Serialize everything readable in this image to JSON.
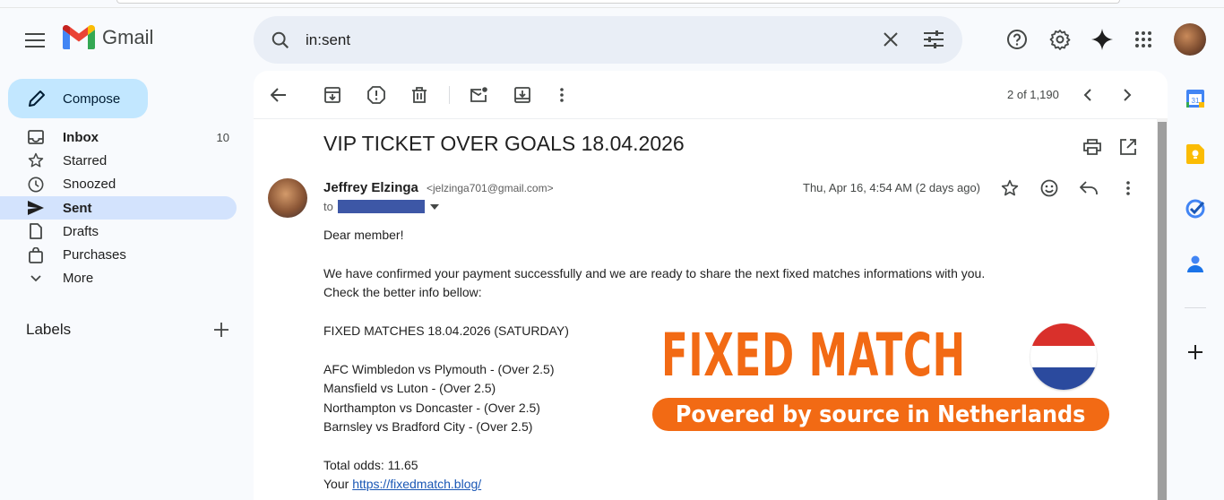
{
  "app": {
    "name": "Gmail",
    "brand_colors": {
      "red": "#ea4335",
      "blue": "#4285f4",
      "green": "#34a853",
      "yellow": "#fbbc04"
    }
  },
  "search": {
    "value": "in:sent",
    "icons": [
      "search-icon",
      "clear-icon",
      "tune-icon"
    ]
  },
  "header_icons": [
    "help-icon",
    "settings-icon",
    "gemini-icon",
    "apps-icon"
  ],
  "compose": {
    "label": "Compose"
  },
  "sidebar": {
    "items": [
      {
        "label": "Inbox",
        "count": "10",
        "icon": "inbox-icon"
      },
      {
        "label": "Starred",
        "icon": "star-icon"
      },
      {
        "label": "Snoozed",
        "icon": "clock-icon"
      },
      {
        "label": "Sent",
        "icon": "send-icon",
        "active": true
      },
      {
        "label": "Drafts",
        "icon": "draft-icon"
      },
      {
        "label": "Purchases",
        "icon": "bag-icon"
      },
      {
        "label": "More",
        "icon": "chevron-down-icon"
      }
    ],
    "labels_title": "Labels"
  },
  "toolbar": {
    "icons": [
      "back-icon",
      "archive-icon",
      "report-icon",
      "delete-icon",
      "mark-unread-icon",
      "move-icon",
      "more-icon"
    ],
    "pager": "2 of 1,190"
  },
  "email": {
    "subject": "VIP TICKET OVER GOALS 18.04.2026",
    "sender_name": "Jeffrey Elzinga",
    "sender_email": "<jelzinga701@gmail.com>",
    "to_label": "to",
    "date": "Thu, Apr 16, 4:54 AM (2 days ago)",
    "body": {
      "greeting": "Dear member!",
      "line1": "We have confirmed your payment successfully and we are ready to share the next fixed matches informations with you.",
      "line2": "Check the better info bellow:",
      "heading": "FIXED MATCHES 18.04.2026 (SATURDAY)",
      "matches": [
        "AFC Wimbledon vs Plymouth - (Over 2.5)",
        "Mansfield vs Luton - (Over 2.5)",
        "Northampton vs Doncaster - (Over 2.5)",
        "Barnsley vs Bradford City - (Over 2.5)"
      ],
      "odds": "Total odds: 11.65",
      "your_prefix": "Your",
      "link": "https://fixedmatch.blog/"
    },
    "banner": {
      "title": "FIXED MATCH",
      "subtitle": "Povered by source in Netherlands",
      "color": "#f26a14",
      "flag_colors": [
        "#d9302b",
        "#ffffff",
        "#2b4a9e"
      ]
    }
  },
  "side_panel": [
    "calendar-icon",
    "keep-icon",
    "tasks-icon",
    "contacts-icon",
    "add-icon"
  ]
}
